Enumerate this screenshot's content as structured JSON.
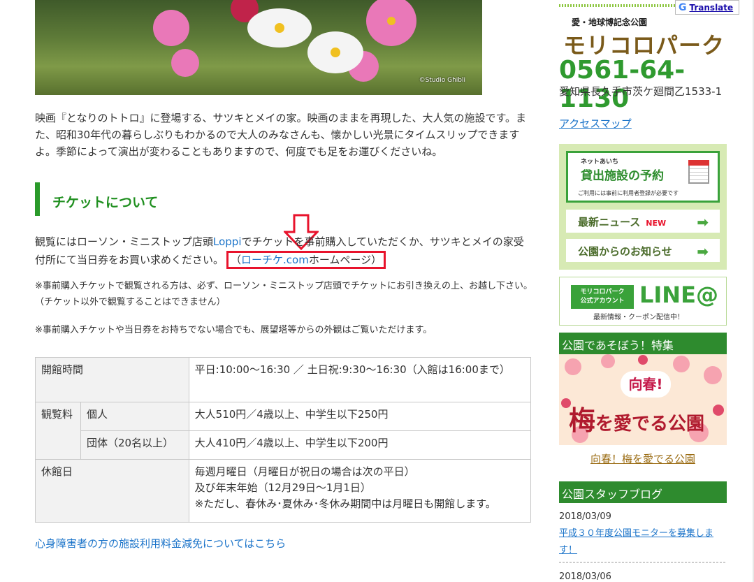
{
  "hero": {
    "credit": "©Studio Ghibli"
  },
  "intro": "映画『となりのトトロ』に登場する、サツキとメイの家。映画のままを再現した、大人気の施設です。また、昭和30年代の暮らしぶりもわかるので大人のみなさんも、懐かしい光景にタイムスリップできますよ。季節によって演出が変わることもありますので、何度でも足をお運びくださいね。",
  "section": {
    "heading": "チケットについて"
  },
  "ticket": {
    "before_link": "観覧にはローソン・ミニストップ店頭",
    "loppi": "Loppi",
    "after_link": "でチケットを事前購入していただくか、サツキとメイの家受付所にて当日券をお買い求めください。",
    "paren_open": "（",
    "lticket_link": "ローチケ.com",
    "lticket_suffix": "ホームページ",
    "paren_close": "）"
  },
  "notes": {
    "note1": "※事前購入チケットで観覧される方は、必ず、ローソン・ミニストップ店頭でチケットにお引き換えの上、お越し下さい。（チケット以外で観覧することはできません）",
    "note2": "※事前購入チケットや当日券をお持ちでない場合でも、展望塔等からの外観はご覧いただけます。"
  },
  "table": {
    "hours_label": "開館時間",
    "hours_value": "平日:10:00〜16:30 ／ 土日祝:9:30〜16:30（入館は16:00まで）",
    "fee_label": "観覧料",
    "individual_label": "個人",
    "individual_value": "大人510円／4歳以上、中学生以下250円",
    "group_label": "団体（20名以上）",
    "group_value": "大人410円／4歳以上、中学生以下200円",
    "closed_label": "休館日",
    "closed_line1": "毎週月曜日（月曜日が祝日の場合は次の平日）",
    "closed_line2": "及び年末年始（12月29日〜1月1日）",
    "closed_line3": "※ただし、春休み･夏休み･冬休み期間中は月曜日も開館します。"
  },
  "reduction_link": "心身障害者の方の施設利用料金減免についてはこちら",
  "sidebar": {
    "translate_g": "G",
    "translate": "Translate",
    "sub_title": "愛・地球博記念公園",
    "park_name": "モリコロパーク",
    "phone": "0561-64-1130",
    "address": "愛知県長久手市茨ケ廻間乙1533-1",
    "access": "アクセスマップ",
    "reserve_small": "ネットあいち",
    "reserve_title": "貸出施設の予約",
    "reserve_note": "ご利用には事前に利用者登録が必要です",
    "news_label": "最新ニュース",
    "news_new": "NEW",
    "notice_label": "公園からのお知らせ",
    "arrow": "➡",
    "line_badge": "モリコロパーク\n公式アカウント",
    "line_at": "LINE@",
    "line_caption": "最新情報・クーポン配信中！",
    "feature_head": "公園であそぼう！特集",
    "feature_spring": "向春!",
    "feature_ume": "梅",
    "feature_ume_rest": "を愛でる公園",
    "feature_caption": "向春！梅を愛でる公園",
    "blog_head": "公園スタッフブログ",
    "blog_date1": "2018/03/09",
    "blog_title1": "平成３０年度公園モニターを募集します！",
    "blog_date2": "2018/03/06"
  },
  "colors": {
    "accent_green": "#2e8b2e",
    "link_blue": "#1a73c9",
    "highlight_red": "#e8132c"
  }
}
